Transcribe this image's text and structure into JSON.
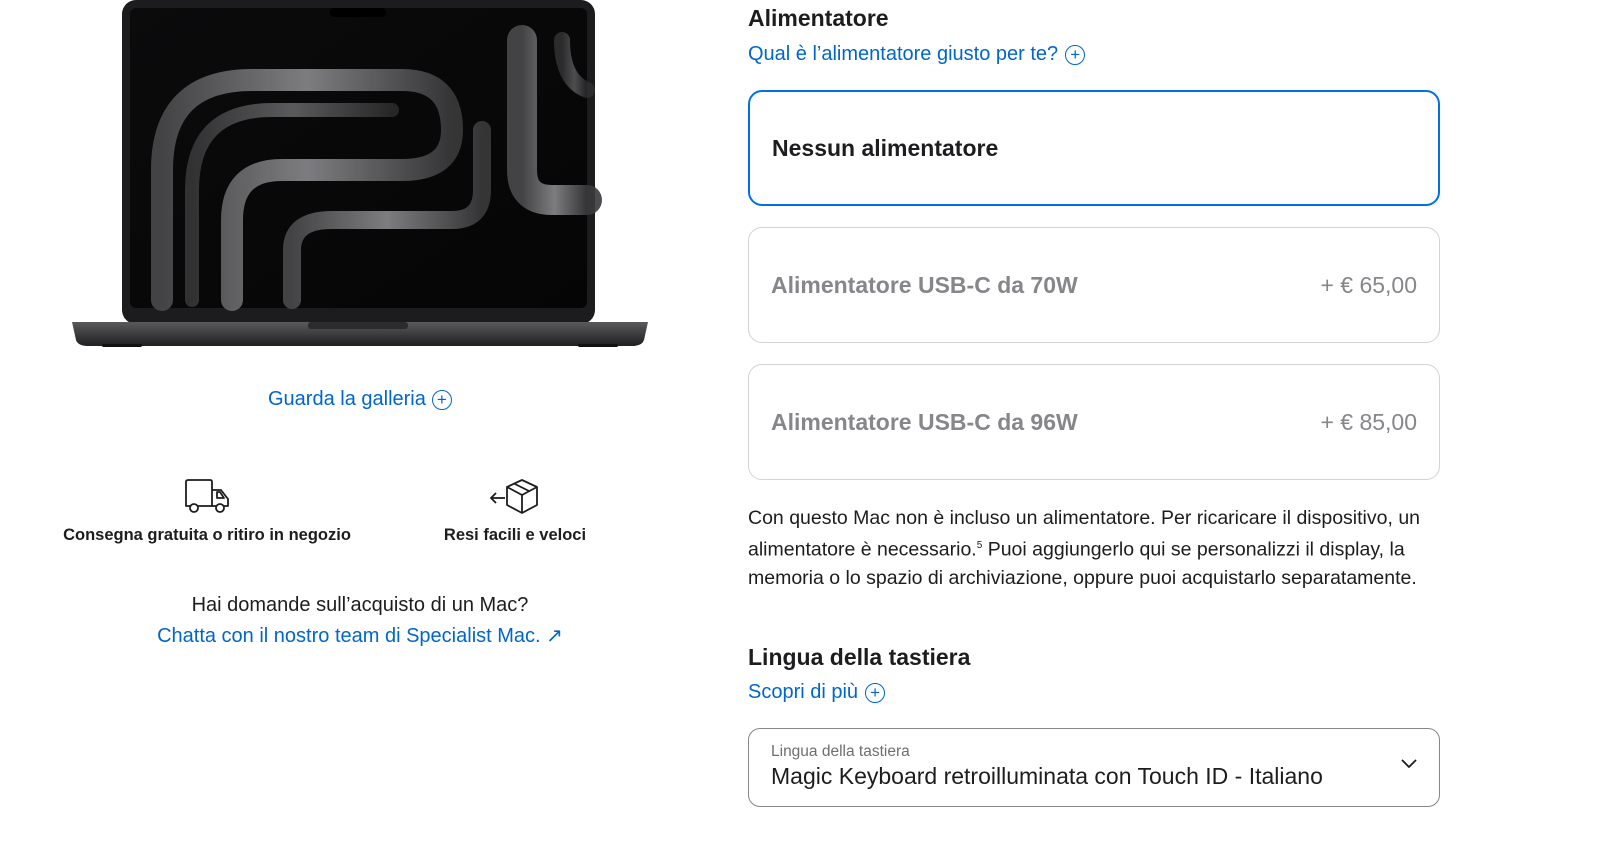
{
  "gallery": {
    "label": "Guarda la galleria",
    "icon": "plus-circle-icon"
  },
  "features": [
    {
      "label": "Consegna gratuita o ritiro in negozio",
      "icon": "delivery-truck-icon"
    },
    {
      "label": "Resi facili e veloci",
      "icon": "return-box-icon"
    }
  ],
  "help": {
    "question": "Hai domande sull’acquisto di un Mac?",
    "chat_link": "Chatta con il nostro team di Specialist Mac. ↗"
  },
  "power": {
    "title": "Alimentatore",
    "help_link": "Qual è l’alimentatore giusto per te?",
    "options": [
      {
        "name": "Nessun alimentatore",
        "price": "",
        "selected": true
      },
      {
        "name": "Alimentatore USB-C da 70W",
        "price": "+ € 65,00",
        "selected": false
      },
      {
        "name": "Alimentatore USB-C da 96W",
        "price": "+ € 85,00",
        "selected": false
      }
    ],
    "note_part1": "Con questo Mac non è incluso un alimentatore. Per ricaricare il dispositivo, un alimentatore è necessario.",
    "note_footnote": "5",
    "note_part2": " Puoi aggiungerlo qui se personalizzi il display, la memoria o lo spazio di archiviazione, oppure puoi acquistarlo separatamente."
  },
  "keyboard": {
    "title": "Lingua della tastiera",
    "help_link": "Scopri di più",
    "select_label": "Lingua della tastiera",
    "select_value": "Magic Keyboard retroilluminata con Touch ID - Italiano"
  },
  "colors": {
    "accent": "#0066cc",
    "selected_border": "#0071e3",
    "disabled_text": "#86868b"
  }
}
